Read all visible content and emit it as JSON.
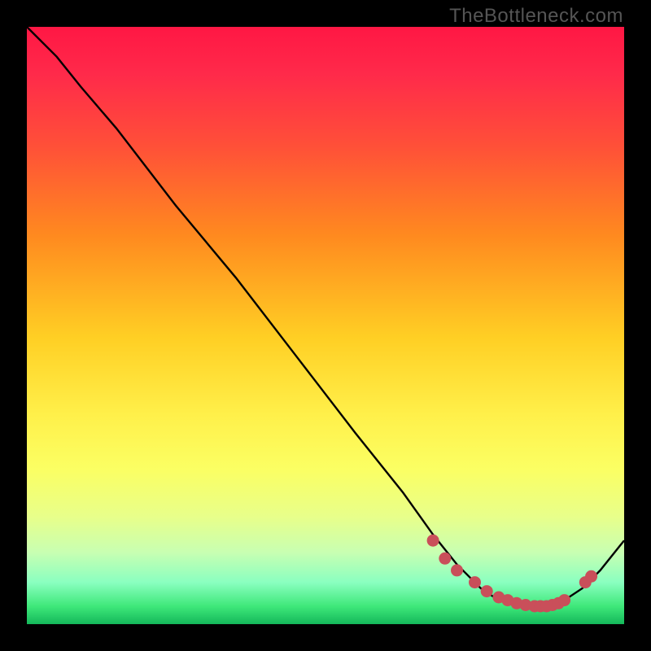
{
  "watermark": "TheBottleneck.com",
  "chart_data": {
    "type": "line",
    "title": "",
    "xlabel": "",
    "ylabel": "",
    "xlim": [
      0,
      100
    ],
    "ylim": [
      0,
      100
    ],
    "series": [
      {
        "name": "curve",
        "x": [
          0,
          5,
          9,
          15,
          25,
          35,
          45,
          55,
          63,
          68,
          72,
          76,
          79,
          83,
          87,
          90,
          93,
          96,
          100
        ],
        "y": [
          100,
          95,
          90,
          83,
          70,
          58,
          45,
          32,
          22,
          15,
          10,
          6,
          4,
          3,
          3,
          4,
          6,
          9,
          14
        ]
      }
    ],
    "markers": {
      "name": "highlight-dots",
      "color": "#c94f5a",
      "x": [
        68,
        70,
        72,
        75,
        77,
        79,
        80.5,
        82,
        83.5,
        85,
        86,
        87,
        88,
        89,
        90,
        93.5,
        94.5
      ],
      "y": [
        14,
        11,
        9,
        7,
        5.5,
        4.5,
        4,
        3.5,
        3.2,
        3,
        3,
        3,
        3.2,
        3.5,
        4,
        7,
        8
      ]
    }
  }
}
